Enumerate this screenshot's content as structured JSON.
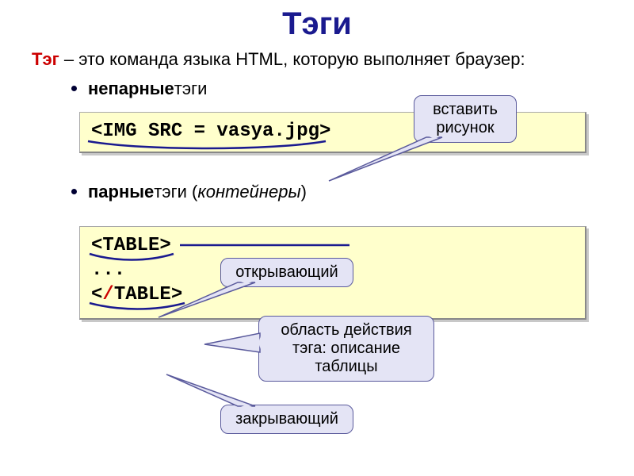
{
  "title": "Тэги",
  "definition": {
    "term": "Тэг",
    "rest": " – это команда языка HTML, которую выполняет браузер:"
  },
  "bullets": {
    "unpaired_bold": "непарные",
    "unpaired_rest": " тэги",
    "paired_bold": "парные",
    "paired_rest": " тэги (",
    "paired_ital": "контейнеры",
    "paired_close": ")"
  },
  "code1": {
    "line": "<IMG SRC = vasya.jpg>"
  },
  "code2": {
    "open_line": "<TABLE>",
    "dots": "...",
    "close_open": "<",
    "close_slash": "/",
    "close_rest": "TABLE>"
  },
  "callouts": {
    "c1_l1": "вставить",
    "c1_l2": "рисунок",
    "c2": "открывающий",
    "c3_l1": "область действия",
    "c3_l2": "тэга: описание",
    "c3_l3": "таблицы",
    "c4": "закрывающий"
  }
}
